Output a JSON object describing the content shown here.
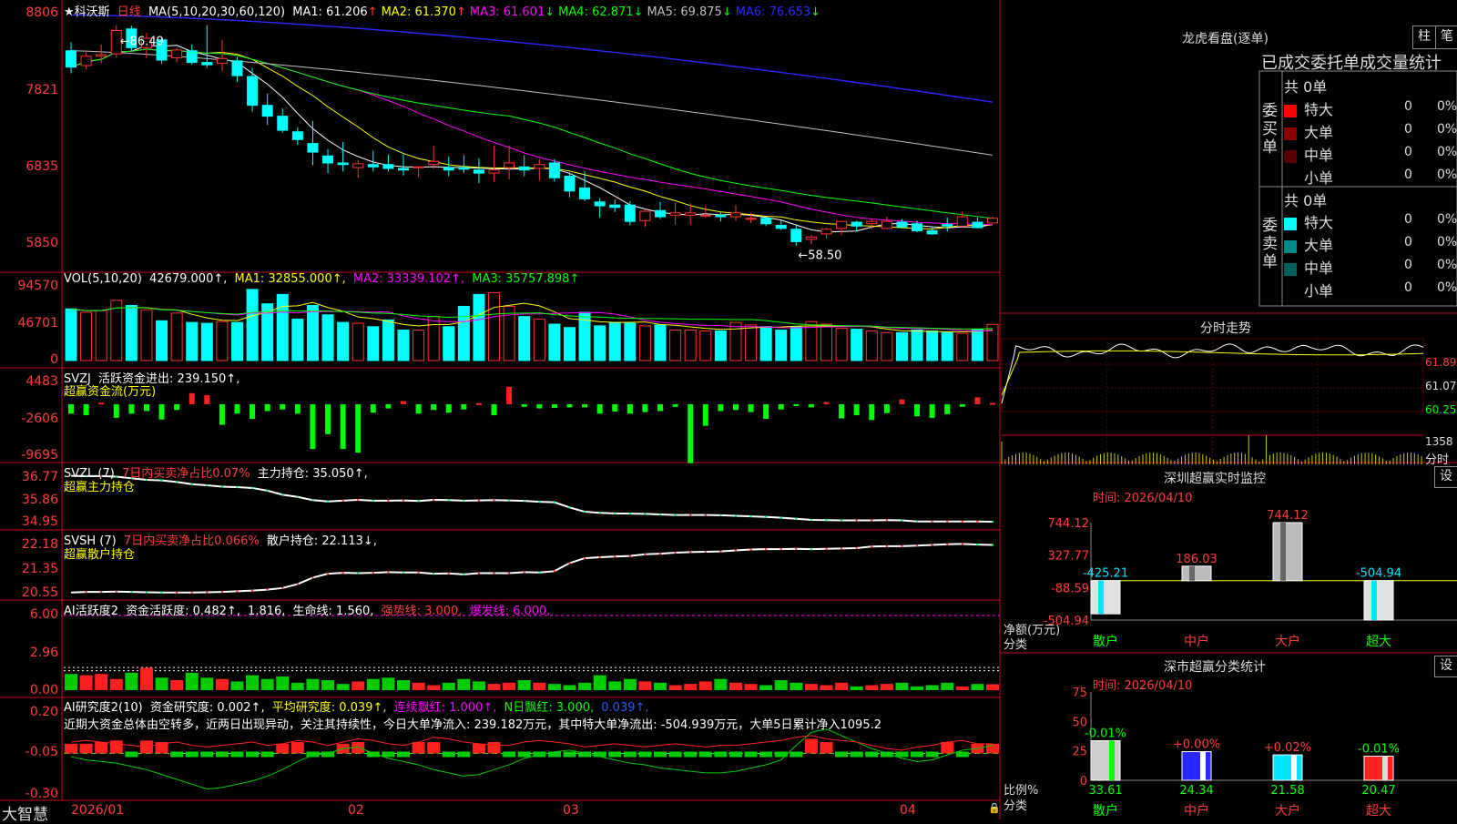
{
  "stock": {
    "name": "★科沃斯",
    "period": "日线",
    "ma_header": {
      "prefix": "MA(5,10,20,30,60,120)",
      "items": [
        {
          "label": "MA1: 61.206",
          "arrow": "↑",
          "color": "#ffffff"
        },
        {
          "label": "MA2: 61.370",
          "arrow": "↑",
          "color": "#ffff00"
        },
        {
          "label": "MA3: 61.601",
          "arrow": "↓",
          "color": "#ff00ff"
        },
        {
          "label": "MA4: 62.871",
          "arrow": "↓",
          "color": "#00ff00"
        },
        {
          "label": "MA5: 69.875",
          "arrow": "↓",
          "color": "#c0c0c0"
        },
        {
          "label": "MA6: 76.653",
          "arrow": "↓",
          "color": "#2a2aff"
        }
      ]
    },
    "high_label": "86.49",
    "low_label": "58.50",
    "axis": {
      "price": [
        "8806",
        "7821",
        "6835",
        "5850"
      ],
      "vol": [
        "94570",
        "46701",
        "0"
      ],
      "svzj": [
        "4483",
        "-2606",
        "-9695"
      ],
      "svzl": [
        "36.77",
        "35.86",
        "34.95"
      ],
      "svsh": [
        "22.18",
        "21.35",
        "20.55"
      ],
      "ai1": [
        "6.00",
        "2.96",
        "0.00"
      ],
      "ai2": [
        "0.20",
        "-0.05",
        "-0.30"
      ]
    },
    "dates": [
      "2026/01",
      "02",
      "03",
      "04"
    ],
    "brand": "大智慧"
  },
  "panels": {
    "vol": {
      "prefix": "VOL(5,10,20)",
      "value": "42679.000↑,",
      "ma1": "MA1: 32855.000↑,",
      "ma2": "MA2: 33339.102↑,",
      "ma3": "MA3: 35757.898↑"
    },
    "svzj": {
      "prefix": "SVZJ",
      "label": "活跃资金进出: 239.150↑,",
      "line2": "超赢资金流(万元)"
    },
    "svzl": {
      "prefix": "SVZL (7)",
      "pct": "7日内买卖净占比0.07%",
      "label": "主力持仓: 35.050↑,",
      "line2": "超赢主力持仓"
    },
    "svsh": {
      "prefix": "SVSH (7)",
      "pct": "7日内买卖净占比0.066%",
      "label": "散户持仓: 22.113↓,",
      "line2": "超赢散户持仓"
    },
    "ai1": {
      "prefix": "AI活跃度2",
      "a": "资金活跃度: 0.482↑,",
      "b": "1.816,",
      "c": "生命线: 1.560,",
      "d": "强势线: 3.000,",
      "e": "爆发线: 6.000,"
    },
    "ai2": {
      "prefix": "AI研究度2(10)",
      "a": "资金研究度: 0.002↑,",
      "b": "平均研究度: 0.039↑,",
      "c": "连续飘红: 1.000↑,",
      "d": "N日飘红: 3.000,",
      "e": "0.039↑,"
    },
    "commentary": "近期大资金总体由空转多，近两日出现异动，关注其持续性，今日大单净流入: 239.182万元，其中特大单净流出: -504.939万元，大单5日累计净入1095.2"
  },
  "right": {
    "lhb_title": "龙虎看盘(逐单)",
    "btn_zhu": "柱",
    "btn_bi": "笔",
    "stat_title": "已成交委托单成交量统计",
    "buy_side": "委买单",
    "sell_side": "委卖单",
    "buy_total": "共 0单",
    "sell_total": "共 0单",
    "buy_rows": [
      {
        "label": "特大",
        "count": "0",
        "pct": "0%",
        "color": "#ff0000"
      },
      {
        "label": "大单",
        "count": "0",
        "pct": "0%",
        "color": "#8b0000"
      },
      {
        "label": "中单",
        "count": "0",
        "pct": "0%",
        "color": "#5a0000"
      },
      {
        "label": "小单",
        "count": "0",
        "pct": "0%",
        "color": "#000000"
      }
    ],
    "sell_rows": [
      {
        "label": "特大",
        "count": "0",
        "pct": "0%",
        "color": "#00ffff"
      },
      {
        "label": "大单",
        "count": "0",
        "pct": "0%",
        "color": "#008b8b"
      },
      {
        "label": "中单",
        "count": "0",
        "pct": "0%",
        "color": "#005f5f"
      },
      {
        "label": "小单",
        "count": "0",
        "pct": "0%",
        "color": "#000000"
      }
    ],
    "intraday_title": "分时走势",
    "intraday_axis": [
      "61.89",
      "61.07",
      "60.25"
    ],
    "intraday_vol": "1358",
    "intraday_unit": "分时",
    "monitor_title": "深圳超赢实时监控",
    "monitor_date": "时间: 2026/04/10",
    "settings_btn": "设",
    "monitor_axis": [
      "744.12",
      "327.77",
      "-88.59",
      "-504.94"
    ],
    "monitor_ylabel": "净额(万元)",
    "monitor_xlabel": "分类",
    "classify_title": "深市超赢分类统计",
    "classify_date": "时间: 2026/04/10",
    "classify_axis": [
      "75",
      "50",
      "25",
      "0"
    ],
    "classify_ylabel": "比例%",
    "classify_xlabel": "分类"
  },
  "chart_data": [
    {
      "type": "candlestick",
      "title": "科沃斯 日线",
      "x_labels": [
        "2026/01",
        "02",
        "03",
        "04"
      ],
      "ylim": [
        58.5,
        88.06
      ],
      "ohlc": [
        [
          83.3,
          84.4,
          80.4,
          81.2
        ],
        [
          81.4,
          83.1,
          80.9,
          82.6
        ],
        [
          82.6,
          84.1,
          81.7,
          82.8
        ],
        [
          82.9,
          86.6,
          82.4,
          85.9
        ],
        [
          86.1,
          86.5,
          83.3,
          83.7
        ],
        [
          83.7,
          85.6,
          82.3,
          84.9
        ],
        [
          84.7,
          85.0,
          81.6,
          82.1
        ],
        [
          82.4,
          83.7,
          81.8,
          83.4
        ],
        [
          83.3,
          84.1,
          81.5,
          81.8
        ],
        [
          81.8,
          86.6,
          81.1,
          81.5
        ],
        [
          81.7,
          84.7,
          80.7,
          82.3
        ],
        [
          82.0,
          82.5,
          79.3,
          80.1
        ],
        [
          80.0,
          81.1,
          75.5,
          76.3
        ],
        [
          76.3,
          77.8,
          73.8,
          74.9
        ],
        [
          74.9,
          75.9,
          72.8,
          73.1
        ],
        [
          72.9,
          73.5,
          71.2,
          71.9
        ],
        [
          71.4,
          74.3,
          68.6,
          70.3
        ],
        [
          69.8,
          70.7,
          67.6,
          68.9
        ],
        [
          68.9,
          71.6,
          67.8,
          68.7
        ],
        [
          68.3,
          69.3,
          67.0,
          68.8
        ],
        [
          68.7,
          70.5,
          67.8,
          68.4
        ],
        [
          68.7,
          70.0,
          67.8,
          68.2
        ],
        [
          68.2,
          70.0,
          67.3,
          68.0
        ],
        [
          68.3,
          68.5,
          67.1,
          68.4
        ],
        [
          68.7,
          71.1,
          68.2,
          69.1
        ],
        [
          68.3,
          69.7,
          67.2,
          68.0
        ],
        [
          68.3,
          69.9,
          67.6,
          68.1
        ],
        [
          68.0,
          69.5,
          66.3,
          67.6
        ],
        [
          67.6,
          71.1,
          66.5,
          68.0
        ],
        [
          68.3,
          71.1,
          66.8,
          68.9
        ],
        [
          68.4,
          69.9,
          67.2,
          68.0
        ],
        [
          68.2,
          69.4,
          66.6,
          68.7
        ],
        [
          68.9,
          69.4,
          66.5,
          67.0
        ],
        [
          67.2,
          67.7,
          64.5,
          65.3
        ],
        [
          65.7,
          67.8,
          64.0,
          64.3
        ],
        [
          63.9,
          64.4,
          61.9,
          63.4
        ],
        [
          63.5,
          64.2,
          62.6,
          63.2
        ],
        [
          63.5,
          64.0,
          60.9,
          61.4
        ],
        [
          61.5,
          63.0,
          60.7,
          62.7
        ],
        [
          62.8,
          63.9,
          61.7,
          62.0
        ],
        [
          62.2,
          63.8,
          61.0,
          62.5
        ],
        [
          62.2,
          63.8,
          61.0,
          62.5
        ],
        [
          62.2,
          63.4,
          61.9,
          62.2
        ],
        [
          62.2,
          62.6,
          61.4,
          62.0
        ],
        [
          62.0,
          63.5,
          61.5,
          62.5
        ],
        [
          61.7,
          62.5,
          61.2,
          61.8
        ],
        [
          61.8,
          61.9,
          60.8,
          61.1
        ],
        [
          60.9,
          61.5,
          60.3,
          60.5
        ],
        [
          60.4,
          61.0,
          58.3,
          58.8
        ],
        [
          59.1,
          59.7,
          58.5,
          59.4
        ],
        [
          59.8,
          60.6,
          59.2,
          60.4
        ],
        [
          60.5,
          61.5,
          59.6,
          61.4
        ],
        [
          61.3,
          61.5,
          60.1,
          60.8
        ],
        [
          61.1,
          61.8,
          60.4,
          61.4
        ],
        [
          60.5,
          62.0,
          60.4,
          61.4
        ],
        [
          61.3,
          61.7,
          60.5,
          60.7
        ],
        [
          61.1,
          61.5,
          60.0,
          60.2
        ],
        [
          60.2,
          60.8,
          59.7,
          59.8
        ],
        [
          61.0,
          61.9,
          60.1,
          60.8
        ],
        [
          60.8,
          62.7,
          60.7,
          62.0
        ],
        [
          61.3,
          61.9,
          60.5,
          60.6
        ],
        [
          61.2,
          62.0,
          61.1,
          61.8
        ]
      ],
      "ma_last": {
        "MA5": 61.206,
        "MA10": 61.37,
        "MA20": 61.601,
        "MA30": 62.871,
        "MA60": 69.875,
        "MA120": 76.653
      }
    },
    {
      "type": "bar",
      "title": "VOL(5,10,20)",
      "ylim": [
        0,
        94570
      ],
      "values": [
        61000,
        57000,
        59000,
        71000,
        65000,
        60000,
        47000,
        56000,
        45000,
        44000,
        46000,
        45000,
        84000,
        67000,
        78000,
        49000,
        65000,
        54000,
        45000,
        44000,
        40000,
        48000,
        36000,
        36000,
        52000,
        40000,
        64000,
        78000,
        80000,
        64000,
        52000,
        49000,
        43000,
        39000,
        57000,
        41000,
        45000,
        44000,
        41000,
        42000,
        36000,
        36000,
        35000,
        35000,
        45000,
        42000,
        40000,
        36000,
        40000,
        46000,
        43000,
        38000,
        37000,
        35000,
        33000,
        33000,
        36000,
        35000,
        33000,
        32000,
        37000,
        42679
      ]
    },
    {
      "type": "bar",
      "title": "SVZJ 活跃资金进出",
      "ylim": [
        -9695,
        4483
      ],
      "values": [
        -1800,
        -2100,
        300,
        -2600,
        -1800,
        -1300,
        -2900,
        -1100,
        2100,
        1700,
        -3900,
        -1800,
        -2800,
        -1300,
        -1000,
        -1800,
        -8500,
        -5700,
        -8500,
        -9200,
        -1600,
        -800,
        600,
        -1800,
        -1100,
        -1600,
        -1000,
        200,
        -2100,
        3300,
        -500,
        -800,
        -700,
        -600,
        -600,
        -1800,
        -1400,
        -1800,
        -1500,
        -1300,
        -500,
        -11200,
        -4100,
        -1300,
        -1100,
        -1500,
        -2800,
        -1000,
        -300,
        -600,
        400,
        -2700,
        -2100,
        -3000,
        -1700,
        900,
        -2300,
        -2600,
        -1900,
        -500,
        1300,
        239
      ]
    },
    {
      "type": "line",
      "title": "SVZL 主力持仓",
      "ylim": [
        34.95,
        36.77
      ],
      "values": [
        36.75,
        36.74,
        36.74,
        36.72,
        36.66,
        36.6,
        36.58,
        36.52,
        36.44,
        36.4,
        36.35,
        36.33,
        36.3,
        36.2,
        36.05,
        35.97,
        35.85,
        35.8,
        35.83,
        35.86,
        35.83,
        35.83,
        35.84,
        35.82,
        35.86,
        35.85,
        35.83,
        35.84,
        35.85,
        35.84,
        35.82,
        35.79,
        35.77,
        35.58,
        35.42,
        35.38,
        35.36,
        35.35,
        35.34,
        35.32,
        35.3,
        35.3,
        35.3,
        35.29,
        35.27,
        35.25,
        35.23,
        35.2,
        35.16,
        35.12,
        35.11,
        35.1,
        35.1,
        35.1,
        35.11,
        35.1,
        35.06,
        35.06,
        35.06,
        35.06,
        35.06,
        35.05
      ]
    },
    {
      "type": "line",
      "title": "SVSH 散户持仓",
      "ylim": [
        20.55,
        22.18
      ],
      "values": [
        20.64,
        20.66,
        20.66,
        20.67,
        20.66,
        20.65,
        20.64,
        20.64,
        20.64,
        20.65,
        20.66,
        20.68,
        20.7,
        20.73,
        20.78,
        20.9,
        21.1,
        21.22,
        21.25,
        21.24,
        21.25,
        21.27,
        21.26,
        21.26,
        21.22,
        21.23,
        21.2,
        21.24,
        21.24,
        21.24,
        21.27,
        21.26,
        21.3,
        21.55,
        21.7,
        21.73,
        21.75,
        21.77,
        21.82,
        21.84,
        21.87,
        21.89,
        21.9,
        21.91,
        21.94,
        21.97,
        21.98,
        21.98,
        21.99,
        21.98,
        21.99,
        22.0,
        22.01,
        22.06,
        22.07,
        22.07,
        22.09,
        22.11,
        22.13,
        22.14,
        22.12,
        22.11
      ]
    },
    {
      "type": "bar",
      "title": "深圳超赢实时监控",
      "categories": [
        "散户",
        "中户",
        "大户",
        "超大"
      ],
      "values": [
        -425.21,
        186.03,
        744.12,
        -504.94
      ],
      "ylim": [
        -504.94,
        744.12
      ]
    },
    {
      "type": "bar",
      "title": "深市超赢分类统计",
      "categories": [
        "散户",
        "中户",
        "大户",
        "超大"
      ],
      "values": [
        33.61,
        24.34,
        21.58,
        20.47
      ],
      "changes": [
        "-0.01%",
        "+0.00%",
        "+0.02%",
        "-0.01%"
      ],
      "ylim": [
        0,
        75
      ]
    }
  ]
}
